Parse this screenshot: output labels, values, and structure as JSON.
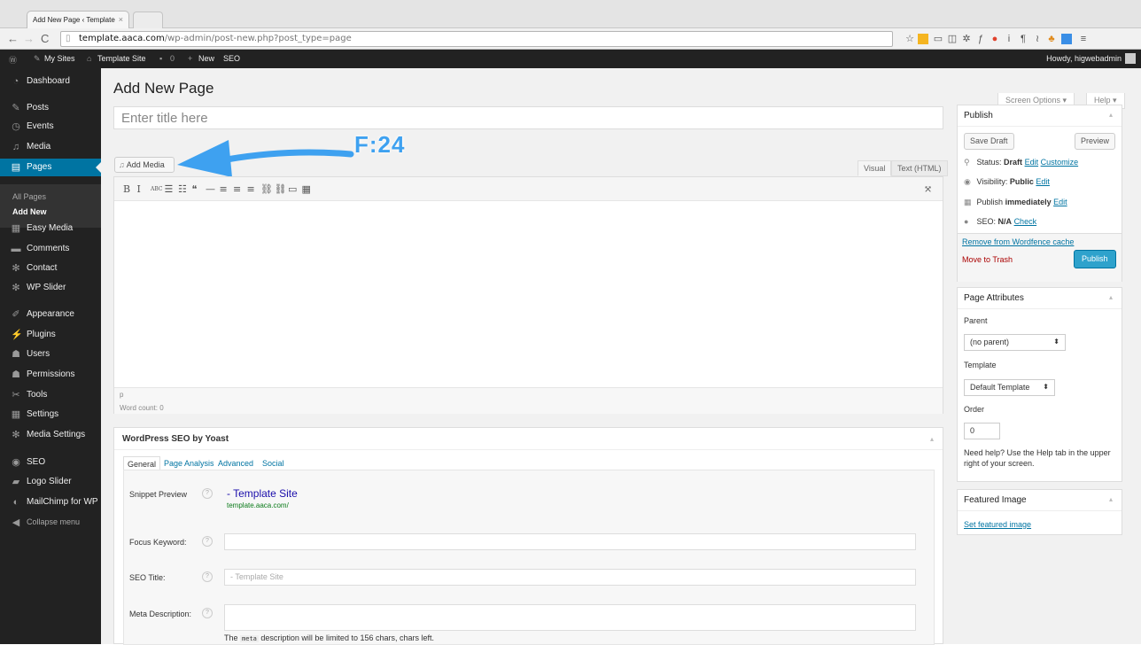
{
  "browser": {
    "tab_title": "Add New Page ‹ Template",
    "tab_close": "×",
    "url_host": "template.aaca.com",
    "url_path": "/wp-admin/post-new.php?post_type=page",
    "page_icon": "▯"
  },
  "adminbar": {
    "wp_icon": "Ⓦ",
    "my_sites": "My Sites",
    "site_name": "Template Site",
    "comments": "0",
    "new_label": "New",
    "seo_label": "SEO",
    "howdy": "Howdy, higwebadmin"
  },
  "sidebar": {
    "items": [
      {
        "label": "Dashboard",
        "icon": "dashboard-icon",
        "glyph": "◔"
      },
      {
        "label": "Posts",
        "icon": "pin-icon",
        "glyph": "✎"
      },
      {
        "label": "Events",
        "icon": "calendar-icon",
        "glyph": "◷"
      },
      {
        "label": "Media",
        "icon": "media-icon",
        "glyph": "♫"
      },
      {
        "label": "Pages",
        "icon": "page-icon",
        "glyph": "▤"
      },
      {
        "label": "Easy Media",
        "icon": "easy-media-icon",
        "glyph": "▦"
      },
      {
        "label": "Comments",
        "icon": "comment-icon",
        "glyph": "▬"
      },
      {
        "label": "Contact",
        "icon": "gear-icon",
        "glyph": "✻"
      },
      {
        "label": "WP Slider",
        "icon": "gear-icon",
        "glyph": "✻"
      },
      {
        "label": "Appearance",
        "icon": "brush-icon",
        "glyph": "✐"
      },
      {
        "label": "Plugins",
        "icon": "plug-icon",
        "glyph": "⚡"
      },
      {
        "label": "Users",
        "icon": "users-icon",
        "glyph": "☗"
      },
      {
        "label": "Permissions",
        "icon": "permissions-icon",
        "glyph": "☗"
      },
      {
        "label": "Tools",
        "icon": "wrench-icon",
        "glyph": "✂"
      },
      {
        "label": "Settings",
        "icon": "settings-icon",
        "glyph": "▦"
      },
      {
        "label": "Media Settings",
        "icon": "gear-icon",
        "glyph": "✻"
      },
      {
        "label": "SEO",
        "icon": "seo-icon",
        "glyph": "◉"
      },
      {
        "label": "Logo Slider",
        "icon": "slider-icon",
        "glyph": "▰"
      },
      {
        "label": "MailChimp for WP",
        "icon": "mailchimp-icon",
        "glyph": "◐"
      },
      {
        "label": "Collapse menu",
        "icon": "collapse-icon",
        "glyph": "◀"
      }
    ],
    "submenu": {
      "all_pages": "All Pages",
      "add_new": "Add New"
    }
  },
  "header": {
    "title": "Add New Page",
    "screen_options": "Screen Options ▾",
    "help": "Help ▾"
  },
  "editor": {
    "title_placeholder": "Enter title here",
    "add_media": "Add Media",
    "tab_visual": "Visual",
    "tab_text": "Text (HTML)",
    "path": "p",
    "word_count": "Word count: 0",
    "toolbar": [
      "B",
      "I",
      "ABC",
      "☰",
      "☷",
      "❝",
      "—",
      "≡",
      "≡",
      "≡",
      "⛓",
      "⛓",
      "▭",
      "▦"
    ],
    "fullscreen_icon": "⤧"
  },
  "annotation": {
    "label": "F:24",
    "color": "#3ea1f0"
  },
  "seo": {
    "title": "WordPress SEO by Yoast",
    "tabs": [
      "General",
      "Page Analysis",
      "Advanced",
      "Social"
    ],
    "snippet_label": "Snippet Preview",
    "snippet_title": "- Template Site",
    "snippet_url": "template.aaca.com/",
    "focus_label": "Focus Keyword:",
    "seo_title_label": "SEO Title:",
    "seo_title_placeholder": "- Template Site",
    "meta_label": "Meta Description:",
    "meta_note_pre": "The",
    "meta_note_code": "meta",
    "meta_note_post": "description will be limited to 156 chars, chars left.",
    "help_glyph": "?"
  },
  "publish": {
    "title": "Publish",
    "save_draft": "Save Draft",
    "preview": "Preview",
    "status_label": "Status:",
    "status_value": "Draft",
    "edit": "Edit",
    "customize": "Customize",
    "visibility_label": "Visibility:",
    "visibility_value": "Public",
    "publish_immediately_pre": "Publish",
    "publish_immediately_bold": "immediately",
    "seo_label": "SEO:",
    "seo_value": "N/A",
    "check": "Check",
    "remove_wordfence": "Remove from Wordfence cache",
    "trash": "Move to Trash",
    "publish_btn": "Publish"
  },
  "attributes": {
    "title": "Page Attributes",
    "parent_label": "Parent",
    "parent_value": "(no parent)",
    "template_label": "Template",
    "template_value": "Default Template",
    "order_label": "Order",
    "order_value": "0",
    "help_text": "Need help? Use the Help tab in the upper right of your screen."
  },
  "featured": {
    "title": "Featured Image",
    "set_link": "Set featured image"
  },
  "colors": {
    "accent": "#0074a2",
    "admin_bar": "#222222",
    "publish_btn": "#2ea2cc"
  }
}
